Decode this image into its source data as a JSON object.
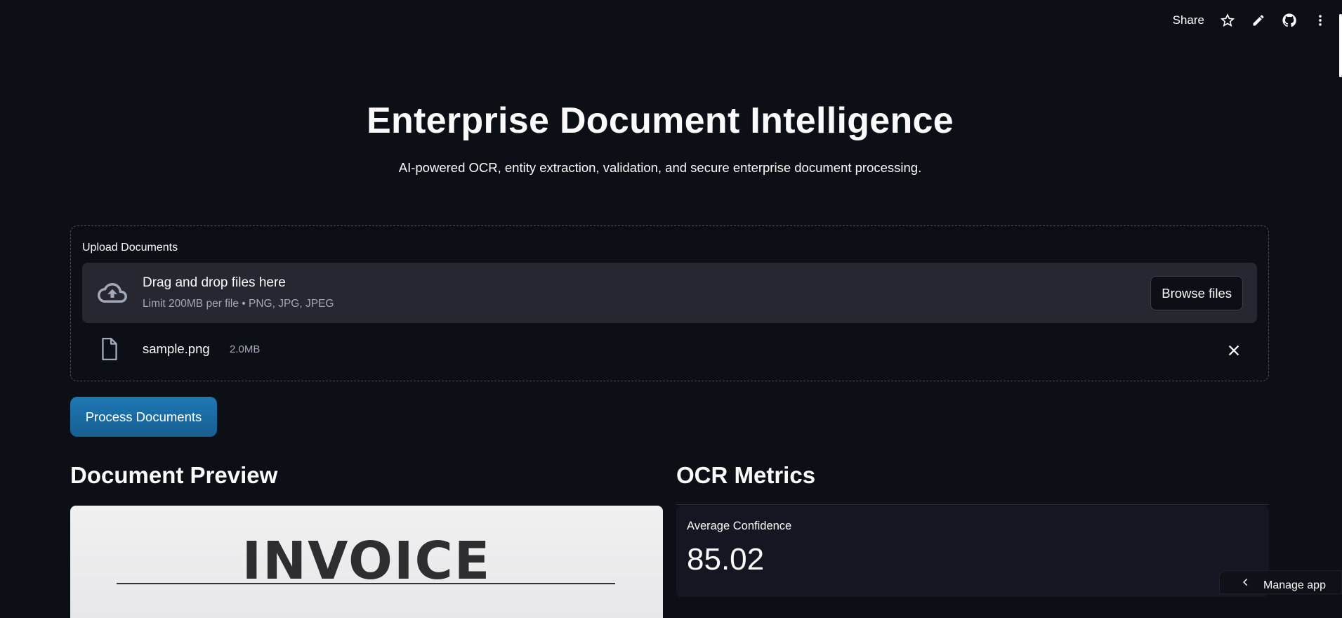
{
  "toolbar": {
    "share_label": "Share",
    "icons": [
      "star-icon",
      "pencil-icon",
      "github-icon",
      "more-vertical-icon"
    ]
  },
  "hero": {
    "title": "Enterprise Document Intelligence",
    "subtitle": "AI-powered OCR, entity extraction, validation, and secure enterprise document processing."
  },
  "uploader": {
    "label": "Upload Documents",
    "drop_title": "Drag and drop files here",
    "drop_limits": "Limit 200MB per file • PNG, JPG, JPEG",
    "browse_label": "Browse files",
    "file": {
      "name": "sample.png",
      "size": "2.0MB"
    }
  },
  "actions": {
    "process_label": "Process Documents",
    "process_color": "#1f78b4"
  },
  "preview": {
    "title": "Document Preview",
    "image_text": "INVOICE"
  },
  "metrics": {
    "title": "OCR Metrics",
    "items": [
      {
        "label": "Average Confidence",
        "value": "85.02"
      }
    ]
  },
  "footer": {
    "manage_label": "Manage app"
  }
}
